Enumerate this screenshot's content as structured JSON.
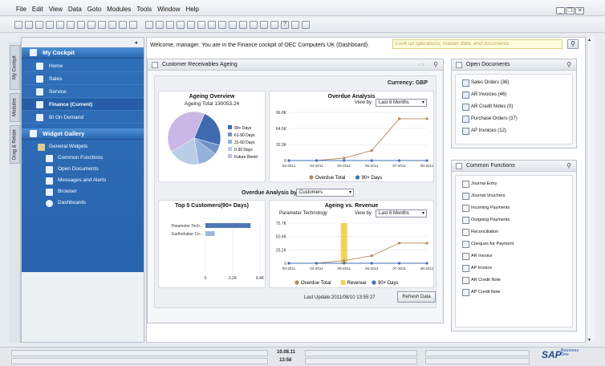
{
  "menu": [
    "File",
    "Edit",
    "View",
    "Data",
    "Goto",
    "Modules",
    "Tools",
    "Window",
    "Help"
  ],
  "window_controls": {
    "minimize": "_",
    "restore": "❐",
    "close": "✕"
  },
  "sidebar": {
    "tabs": [
      "My Cockpit",
      "Modules",
      "Drag & Relate"
    ],
    "cockpit_title": "My Cockpit",
    "items": [
      {
        "label": "Home",
        "icon": "home-icon"
      },
      {
        "label": "Sales",
        "icon": "sales-icon"
      },
      {
        "label": "Service",
        "icon": "service-icon"
      },
      {
        "label": "Finance (Current)",
        "icon": "finance-icon"
      },
      {
        "label": "BI On Demand",
        "icon": "bi-icon"
      }
    ],
    "gallery_title": "Widget Gallery",
    "group": "General Widgets",
    "sub_items": [
      "Common Functions",
      "Open Documents",
      "Messages and Alerts",
      "Browser",
      "Dashboards"
    ]
  },
  "header": {
    "welcome": "Welcome, manager. You are in the Finance cockpit of OEC Computers UK (Dashboard).",
    "search_placeholder": "Look up operations, master data, and documents"
  },
  "ageing_panel": {
    "title": "Customer Receivables Ageing",
    "currency": "Currency: GBP",
    "overview_title": "Ageing Overview",
    "ageing_total": "Ageing Total  130053.24",
    "overdue_title": "Overdue Analysis",
    "view_by_label": "View by",
    "view_by_value": "Last 6 Months",
    "overdue_by_label": "Overdue Analysis by",
    "overdue_by_value": "Customers",
    "top5_title": "Top 5 Customers(90+ Days)",
    "ageing_revenue_title": "Ageing vs. Revenue",
    "customer_name": "Parameter Technology",
    "last_update": "Last Update:2011/08/10 13:55:27",
    "refresh_label": "Refresh Data"
  },
  "open_documents": {
    "title": "Open Documents",
    "items": [
      "Sales Orders (36)",
      "AR Invoices (46)",
      "AR Credit Notes (0)",
      "Purchase Orders (37)",
      "AP Invoices (12)"
    ]
  },
  "common_functions": {
    "title": "Common Functions",
    "items": [
      "Journal Entry",
      "Journal Vouchers",
      "Incoming Payments",
      "Outgoing Payments",
      "Reconciliation",
      "Cheques for Payment",
      "AR Invoice",
      "AP Invoice",
      "AR Credit Note",
      "AP Credit Note"
    ]
  },
  "status": {
    "date": "10.08.11",
    "time": "13:58"
  },
  "brand": {
    "name": "SAP",
    "suffix": "Business One"
  },
  "colors": {
    "nav_blue": "#2a68b2",
    "series_overdue": "#b08a55",
    "series_90": "#3f6fb3",
    "revenue": "#f2d35a"
  },
  "chart_data": [
    {
      "type": "pie",
      "title": "Ageing Overview",
      "categories": [
        "90+ Days",
        "61-90 Days",
        "31-60 Days",
        "0-30 Days",
        "Future Remit"
      ],
      "values": [
        23,
        6,
        12,
        19,
        40
      ],
      "colors": [
        "#3f6ab0",
        "#6f93c8",
        "#94b1d8",
        "#b9cde6",
        "#c9b8e6"
      ]
    },
    {
      "type": "line",
      "title": "Overdue Analysis",
      "x": [
        "03-2011",
        "04-2011",
        "05-2011",
        "06-2011",
        "07-2011",
        "08-2011"
      ],
      "y_ticks": [
        "0",
        "32.3K",
        "64.5K",
        "96.8K"
      ],
      "ylim": [
        0,
        96800
      ],
      "series": [
        {
          "name": "Overdue Total",
          "values": [
            0,
            0,
            5000,
            20000,
            84000,
            84000
          ],
          "color": "#b08a55"
        },
        {
          "name": "90+ Days",
          "values": [
            0,
            0,
            0,
            0,
            0,
            0
          ],
          "color": "#3f6fb3"
        }
      ]
    },
    {
      "type": "bar",
      "title": "Top 5 Customers(90+ Days)",
      "categories": [
        "Parameter Tech...",
        "Earthshaker Co..."
      ],
      "values": [
        5300,
        1100
      ],
      "x_ticks": [
        "0",
        "3.2K",
        "6.4K"
      ],
      "xlim": [
        0,
        6400
      ],
      "colors": [
        "#4f77b7",
        "#9db8df"
      ]
    },
    {
      "type": "line",
      "title": "Ageing vs. Revenue",
      "x": [
        "03-2011",
        "04-2011",
        "05-2011",
        "06-2011",
        "07-2011",
        "08-2011"
      ],
      "y_ticks": [
        "0",
        "25.2K",
        "50.4K",
        "75.7K"
      ],
      "ylim": [
        0,
        75700
      ],
      "revenue": {
        "name": "Revenue",
        "category": "05-2011",
        "value": 75700
      },
      "series": [
        {
          "name": "Overdue Total",
          "values": [
            0,
            0,
            5000,
            14000,
            38000,
            38000
          ],
          "color": "#b08a55"
        },
        {
          "name": "90+ Days",
          "values": [
            0,
            0,
            0,
            0,
            0,
            0
          ],
          "color": "#3f6fb3"
        }
      ]
    }
  ]
}
